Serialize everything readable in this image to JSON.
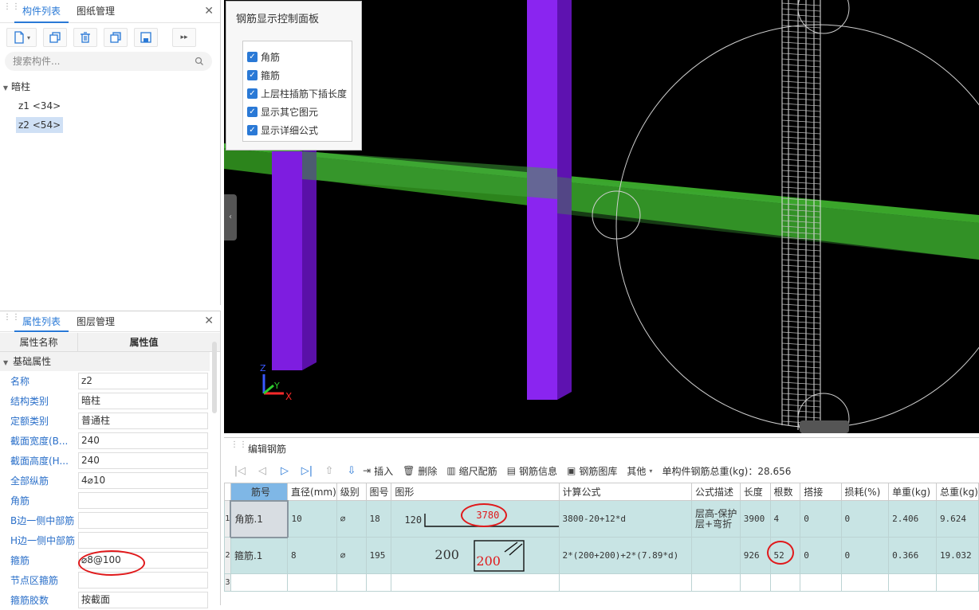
{
  "comp_panel": {
    "tab_active": "构件列表",
    "tab_other": "图纸管理",
    "search_placeholder": "搜索构件...",
    "tree_root": "暗柱",
    "tree_items": [
      "z1 <34>",
      "z2 <54>"
    ]
  },
  "prop_panel": {
    "tab_active": "属性列表",
    "tab_other": "图层管理",
    "col_name": "属性名称",
    "col_value": "属性值",
    "group": "基础属性",
    "rows": [
      {
        "name": "名称",
        "value": "z2"
      },
      {
        "name": "结构类别",
        "value": "暗柱"
      },
      {
        "name": "定额类别",
        "value": "普通柱"
      },
      {
        "name": "截面宽度(B...",
        "value": "240"
      },
      {
        "name": "截面高度(H...",
        "value": "240"
      },
      {
        "name": "全部纵筋",
        "value": "4⌀10"
      },
      {
        "name": "角筋",
        "value": ""
      },
      {
        "name": "B边一侧中部筋",
        "value": ""
      },
      {
        "name": "H边一侧中部筋",
        "value": ""
      },
      {
        "name": "箍筋",
        "value": "⌀8@100"
      },
      {
        "name": "节点区箍筋",
        "value": ""
      },
      {
        "name": "箍筋胶数",
        "value": "按截面"
      }
    ]
  },
  "ctrl_panel": {
    "title": "钢筋显示控制面板",
    "options": [
      "角筋",
      "箍筋",
      "上层柱插筋下插长度",
      "显示其它图元",
      "显示详细公式"
    ]
  },
  "axes": {
    "z": "Z",
    "y": "Y",
    "x": "X"
  },
  "rebar_panel": {
    "title": "编辑钢筋",
    "actions": [
      "插入",
      "删除",
      "缩尺配筋",
      "钢筋信息",
      "钢筋图库",
      "其他"
    ],
    "total_weight": "单构件钢筋总重(kg)：28.656",
    "columns": [
      "筋号",
      "直径(mm)",
      "级别",
      "图号",
      "图形",
      "计算公式",
      "公式描述",
      "长度",
      "根数",
      "搭接",
      "损耗(%)",
      "单重(kg)",
      "总重(kg)"
    ],
    "rows": [
      {
        "idx": "1",
        "bar": "角筋.1",
        "dia": "10",
        "grade": "⌀",
        "fig": "18",
        "shape_a": "120",
        "shape_b": "3780",
        "formula": "3800-20+12*d",
        "desc": "层高-保护层+弯折",
        "len": "3900",
        "count": "4",
        "lap": "0",
        "loss": "0",
        "unit": "2.406",
        "total": "9.624"
      },
      {
        "idx": "2",
        "bar": "箍筋.1",
        "dia": "8",
        "grade": "⌀",
        "fig": "195",
        "shape_a": "200",
        "shape_b": "200",
        "formula": "2*(200+200)+2*(7.89*d)",
        "desc": "",
        "len": "926",
        "count": "52",
        "lap": "0",
        "loss": "0",
        "unit": "0.366",
        "total": "19.032"
      },
      {
        "idx": "3"
      }
    ]
  }
}
